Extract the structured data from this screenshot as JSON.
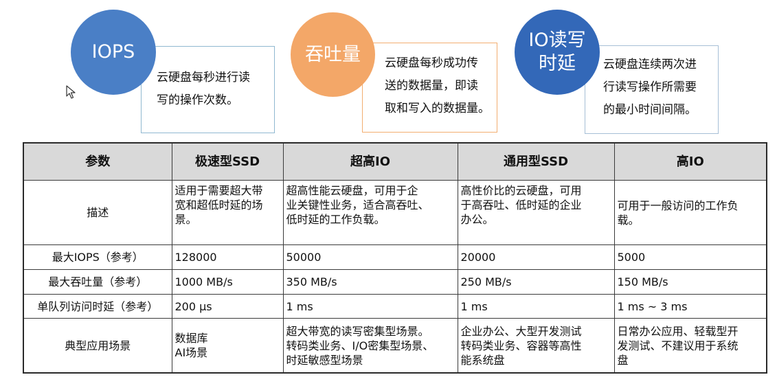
{
  "metrics": [
    {
      "title": "IOPS",
      "lines": [
        "云硬盘每秒进行读",
        "写的操作次数。"
      ]
    },
    {
      "title": "吞吐量",
      "lines": [
        "云硬盘每秒成功传",
        "送的数据量，即读",
        "取和写入的数据量。"
      ]
    },
    {
      "title_lines": [
        "IO读写",
        "时延"
      ],
      "lines": [
        "云硬盘连续两次进",
        "行读写操作所需要",
        "的最小时间间隔。"
      ]
    }
  ],
  "table": {
    "headers": [
      "参数",
      "极速型SSD",
      "超高IO",
      "通用型SSD",
      "高IO"
    ],
    "rows": [
      {
        "label": "描述",
        "cells": [
          [
            "适用于需要超大带",
            "宽和超低时延的场",
            "景。"
          ],
          [
            "超高性能云硬盘，可用于企",
            "业关键性业务，适合高吞吐、",
            "低时延的工作负载。"
          ],
          [
            "高性价比的云硬盘，可用",
            "于高吞吐、低时延的企业",
            "办公。"
          ],
          [
            "可用于一般访问的工作负",
            "载。"
          ]
        ]
      },
      {
        "label": "最大IOPS（参考）",
        "cells": [
          "128000",
          "50000",
          "20000",
          "5000"
        ]
      },
      {
        "label": "最大吞吐量（参考）",
        "cells": [
          "1000 MB/s",
          "350 MB/s",
          "250 MB/s",
          "150 MB/s"
        ]
      },
      {
        "label": "单队列访问时延（参考）",
        "cells": [
          "200 µs",
          "1 ms",
          "1 ms",
          "1 ms ~ 3 ms"
        ]
      },
      {
        "label": "典型应用场景",
        "cells": [
          [
            "数据库",
            "AI场景"
          ],
          [
            "超大带宽的读写密集型场景。",
            "转码类业务、I/O密集型场景、",
            "时延敏感型场景"
          ],
          [
            "企业办公、大型开发测试",
            "转码类业务、容器等高性",
            "能系统盘"
          ],
          [
            "日常办公应用、轻载型开",
            "发测试、不建议用于系统",
            "盘"
          ]
        ]
      }
    ]
  },
  "colors": {
    "iops_circle": "#4a7fc6",
    "throughput_circle": "#f3a768",
    "latency_circle": "#3368b8",
    "header_bg": "#d9d9d9"
  }
}
